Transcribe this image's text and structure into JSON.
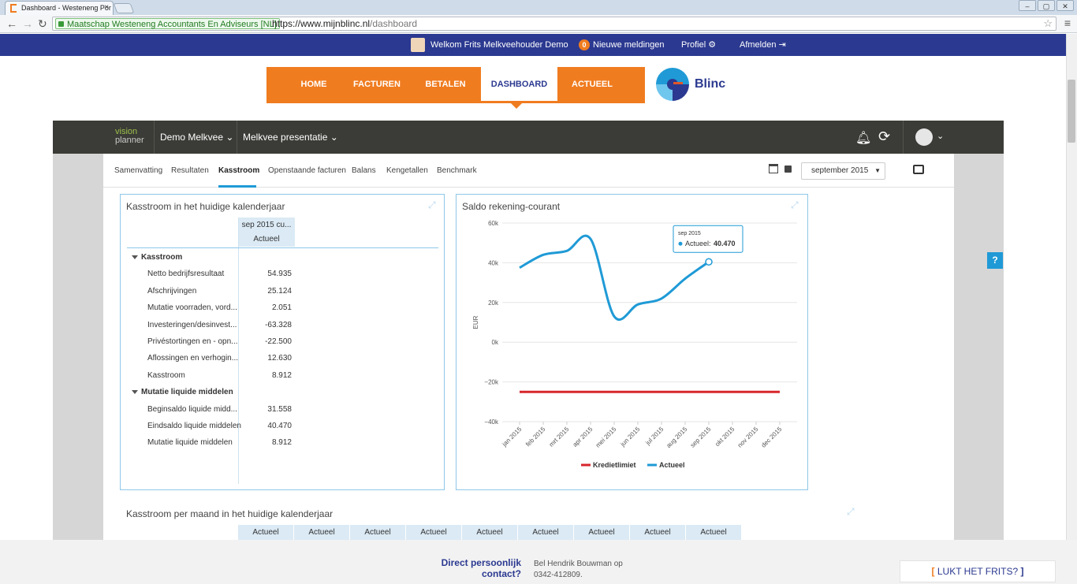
{
  "browser": {
    "tab_title": "Dashboard - Westeneng Por",
    "close_glyph": "×",
    "win_min": "‒",
    "win_max": "▢",
    "win_close": "✕",
    "cert_org": "Maatschap Westeneng Accountants En Adviseurs [NL]",
    "url_host": "https://www.mijnblinc.nl",
    "url_path": "/dashboard"
  },
  "userbar": {
    "welcome": "Welkom Frits Melkveehouder Demo",
    "notif_count": "0",
    "notif_label": "Nieuwe meldingen",
    "profile": "Profiel",
    "logout": "Afmelden"
  },
  "mainnav": {
    "items": [
      "HOME",
      "FACTUREN",
      "BETALEN",
      "DASHBOARD",
      "ACTUEEL"
    ],
    "active": "DASHBOARD"
  },
  "brand": {
    "name": "Blinc",
    "accent": "#f07c20",
    "primary": "#2b3990",
    "highlight": "#1f9ad6"
  },
  "visionplanner": {
    "logo_line1": "vision",
    "logo_line2": "planner",
    "company": "Demo Melkvee",
    "presentation": "Melkvee presentatie"
  },
  "subtabs": [
    "Samenvatting",
    "Resultaten",
    "Kasstroom",
    "Openstaande facturen",
    "Balans",
    "Kengetallen",
    "Benchmark"
  ],
  "period": "september 2015",
  "kasstroom_panel": {
    "title": "Kasstroom in het huidige kalenderjaar",
    "col_header": "sep 2015 cu...",
    "col_sub": "Actueel",
    "rows": [
      {
        "label": "Kasstroom",
        "value": "",
        "group": true
      },
      {
        "label": "Netto bedrijfsresultaat",
        "value": "54.935"
      },
      {
        "label": "Afschrijvingen",
        "value": "25.124"
      },
      {
        "label": "Mutatie voorraden, vord...",
        "value": "2.051"
      },
      {
        "label": "Investeringen/desinvest...",
        "value": "-63.328"
      },
      {
        "label": "Privéstortingen en - opn...",
        "value": "-22.500"
      },
      {
        "label": "Aflossingen en verhogin...",
        "value": "12.630"
      },
      {
        "label": "Kasstroom",
        "value": "8.912"
      },
      {
        "label": "Mutatie liquide middelen",
        "value": "",
        "group": true
      },
      {
        "label": "Beginsaldo liquide midd...",
        "value": "31.558"
      },
      {
        "label": "Eindsaldo liquide middelen",
        "value": "40.470"
      },
      {
        "label": "Mutatie liquide middelen",
        "value": "8.912"
      }
    ]
  },
  "chart_data": {
    "type": "line",
    "title": "Saldo rekening-courant",
    "ylabel": "EUR",
    "ylim": [
      -40000,
      60000
    ],
    "yticks": [
      "60k",
      "40k",
      "20k",
      "0k",
      "−20k",
      "−40k"
    ],
    "categories": [
      "jan 2015",
      "feb 2015",
      "mrt 2015",
      "apr 2015",
      "mei 2015",
      "jun 2015",
      "jul 2015",
      "aug 2015",
      "sep 2015",
      "okt 2015",
      "nov 2015",
      "dec 2015"
    ],
    "series": [
      {
        "name": "Kredietlimiet",
        "color": "#d7262c",
        "values": [
          -25000,
          -25000,
          -25000,
          -25000,
          -25000,
          -25000,
          -25000,
          -25000,
          -25000,
          -25000,
          -25000,
          -25000
        ]
      },
      {
        "name": "Actueel",
        "color": "#1f9ad6",
        "values": [
          37500,
          44000,
          46000,
          52000,
          13000,
          19000,
          22000,
          32000,
          40470,
          null,
          null,
          null
        ]
      }
    ],
    "tooltip": {
      "period": "sep 2015",
      "label": "Actueel:",
      "value": "40.470"
    },
    "legend": "bottom",
    "grid": true
  },
  "bottom_panel": {
    "title": "Kasstroom per maand in het huidige kalenderjaar",
    "cols": [
      "Actueel",
      "Actueel",
      "Actueel",
      "Actueel",
      "Actueel",
      "Actueel",
      "Actueel",
      "Actueel",
      "Actueel"
    ]
  },
  "help": "?",
  "footer": {
    "contact_line1": "Direct persoonlijk",
    "contact_line2": "contact?",
    "bel_line1": "Bel Hendrik Bouwman op",
    "bel_line2": "0342-412809.",
    "lukt": "LUKT HET FRITS?"
  }
}
